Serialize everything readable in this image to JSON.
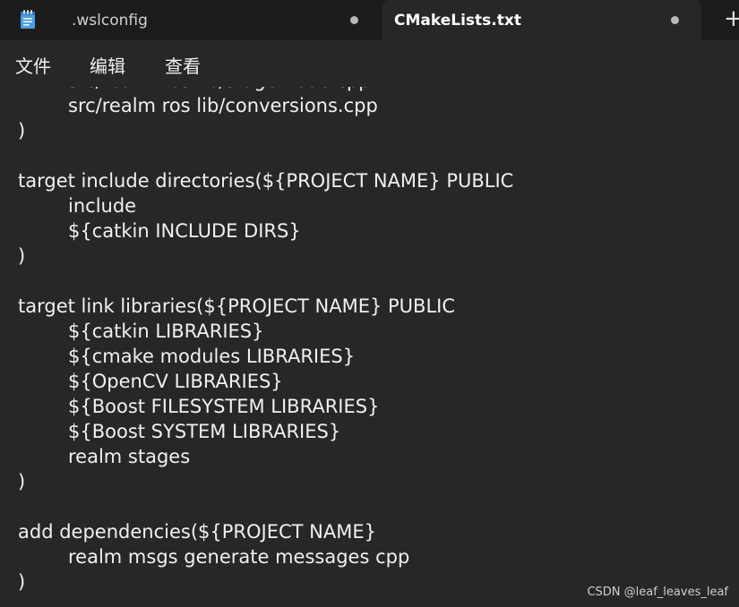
{
  "tabs": [
    {
      "label": ".wslconfig",
      "modified": true
    },
    {
      "label": "CMakeLists.txt",
      "modified": true,
      "active": true
    }
  ],
  "new_tab_label": "+",
  "menu": {
    "file": "文件",
    "edit": "编辑",
    "view": "查看"
  },
  "editor": {
    "lines": [
      {
        "text": "src/realm ros lib/stage node.cpp",
        "indent": true
      },
      {
        "text": "src/realm ros lib/conversions.cpp",
        "indent": true
      },
      {
        "text": ")",
        "indent": false
      },
      {
        "text": "",
        "indent": false
      },
      {
        "text": "target include directories(${PROJECT NAME} PUBLIC",
        "indent": false
      },
      {
        "text": "include",
        "indent": true
      },
      {
        "text": "${catkin INCLUDE DIRS}",
        "indent": true
      },
      {
        "text": ")",
        "indent": false
      },
      {
        "text": "",
        "indent": false
      },
      {
        "text": "target link libraries(${PROJECT NAME} PUBLIC",
        "indent": false
      },
      {
        "text": "${catkin LIBRARIES}",
        "indent": true
      },
      {
        "text": "${cmake modules LIBRARIES}",
        "indent": true
      },
      {
        "text": "${OpenCV LIBRARIES}",
        "indent": true
      },
      {
        "text": "${Boost FILESYSTEM LIBRARIES}",
        "indent": true
      },
      {
        "text": "${Boost SYSTEM LIBRARIES}",
        "indent": true
      },
      {
        "text": "realm stages",
        "indent": true
      },
      {
        "text": ")",
        "indent": false
      },
      {
        "text": "",
        "indent": false
      },
      {
        "text": "add dependencies(${PROJECT NAME}",
        "indent": false
      },
      {
        "text": "realm msgs generate messages cpp",
        "indent": true
      },
      {
        "text": ")",
        "indent": false
      }
    ]
  },
  "watermark": "CSDN @leaf_leaves_leaf",
  "colors": {
    "titlebar_bg": "#1c1c1c",
    "editor_bg": "#272727",
    "text": "#f0f0f0",
    "icon_accent": "#4a9de0"
  }
}
